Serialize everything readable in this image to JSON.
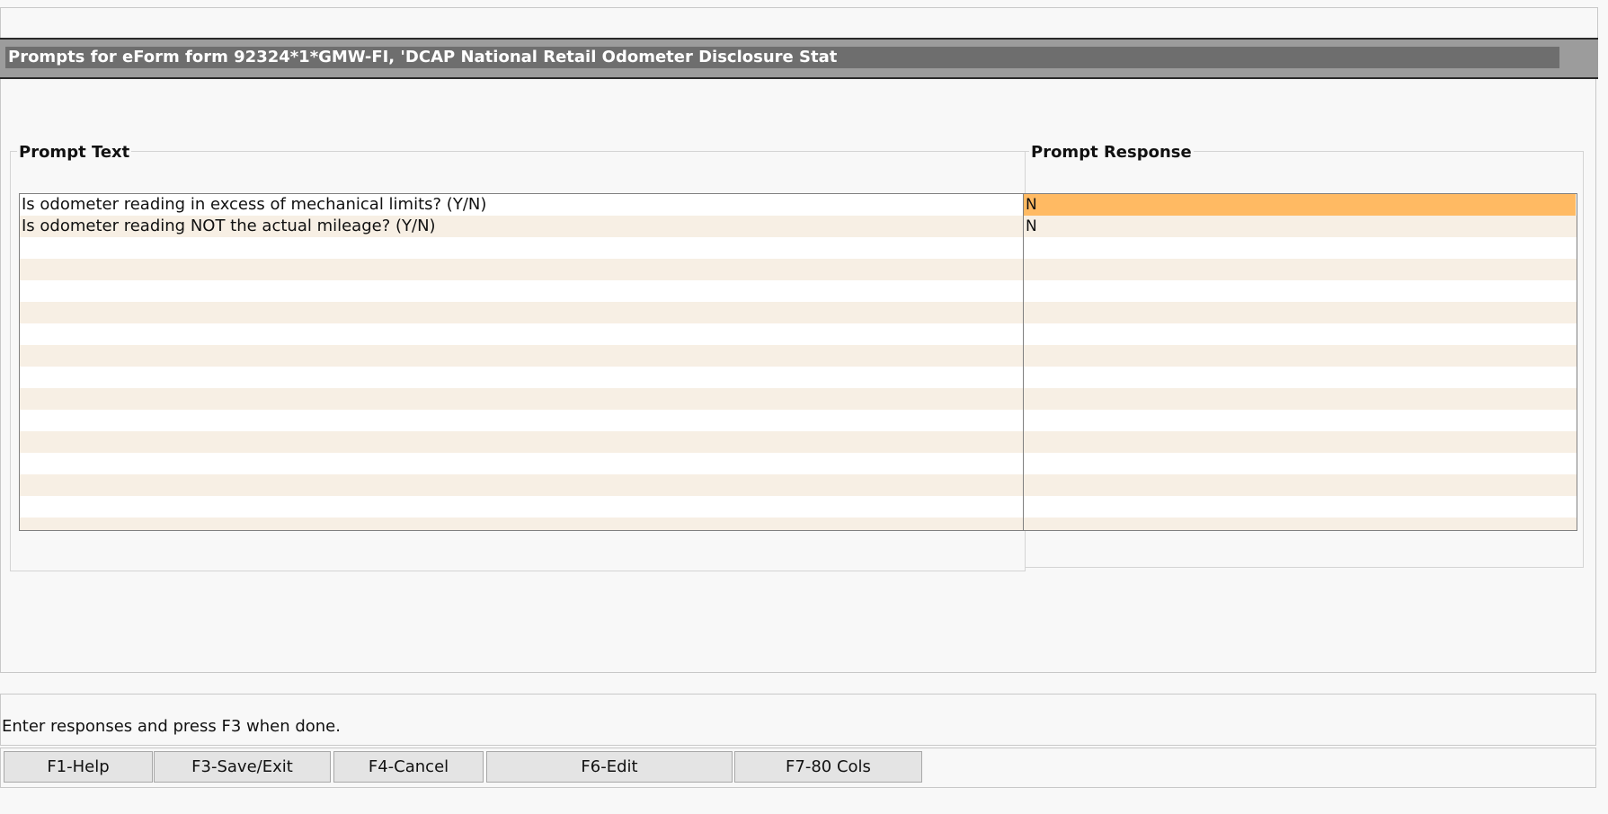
{
  "window": {
    "title": "Prompts for eForm form 92324*1*GMW-FI, 'DCAP National Retail Odometer Disclosure Stat"
  },
  "columns": {
    "prompt_text": "Prompt Text",
    "prompt_response": "Prompt Response"
  },
  "rows": [
    {
      "text": "Is odometer reading in excess of mechanical limits? (Y/N)",
      "response": "N",
      "active": true
    },
    {
      "text": "Is odometer reading NOT the actual mileage? (Y/N)",
      "response": "N",
      "active": false
    },
    {
      "text": "",
      "response": "",
      "active": false
    },
    {
      "text": "",
      "response": "",
      "active": false
    },
    {
      "text": "",
      "response": "",
      "active": false
    },
    {
      "text": "",
      "response": "",
      "active": false
    },
    {
      "text": "",
      "response": "",
      "active": false
    },
    {
      "text": "",
      "response": "",
      "active": false
    },
    {
      "text": "",
      "response": "",
      "active": false
    },
    {
      "text": "",
      "response": "",
      "active": false
    },
    {
      "text": "",
      "response": "",
      "active": false
    },
    {
      "text": "",
      "response": "",
      "active": false
    },
    {
      "text": "",
      "response": "",
      "active": false
    },
    {
      "text": "",
      "response": "",
      "active": false
    },
    {
      "text": "",
      "response": "",
      "active": false
    },
    {
      "text": "",
      "response": "",
      "active": false
    }
  ],
  "status": {
    "message": "Enter responses and press F3 when done."
  },
  "function_keys": [
    {
      "name": "f1-help-button",
      "label": "F1-Help"
    },
    {
      "name": "f3-save-exit-button",
      "label": "F3-Save/Exit"
    },
    {
      "name": "f4-cancel-button",
      "label": "F4-Cancel"
    },
    {
      "name": "f6-edit-button",
      "label": "F6-Edit"
    },
    {
      "name": "f7-80-cols-button",
      "label": "F7-80 Cols"
    }
  ],
  "colors": {
    "active_response": "#ffba63",
    "alt_row": "#f7efe4",
    "title_bar": "#6e6e6e"
  }
}
